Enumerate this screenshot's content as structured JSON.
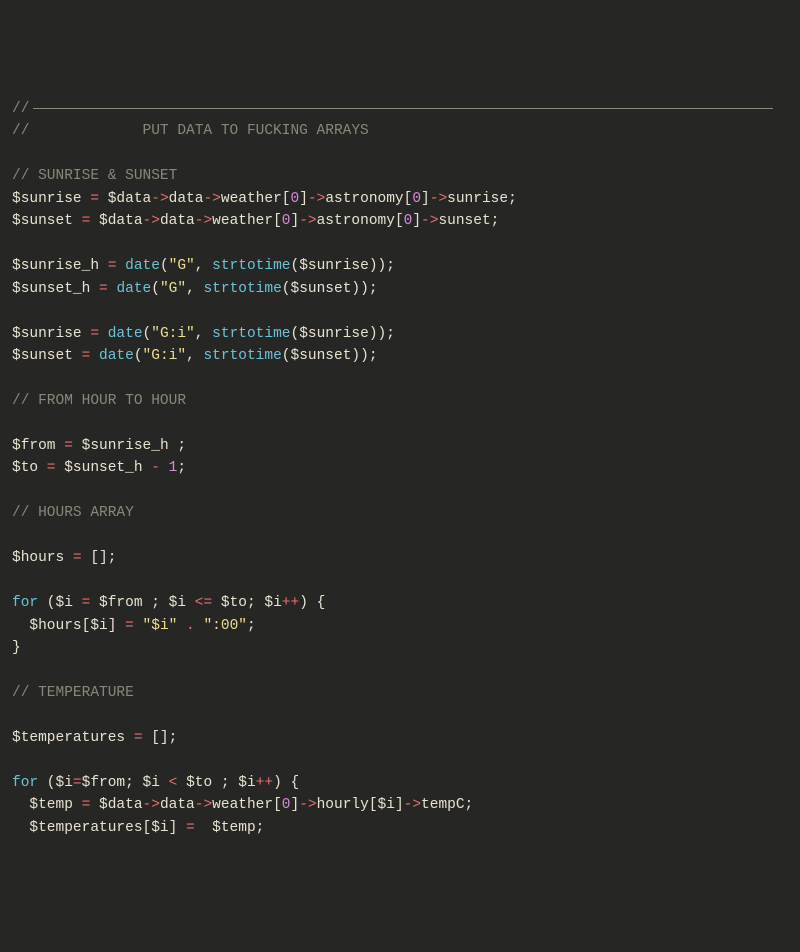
{
  "lines": {
    "l1_cm": "//",
    "l2_cm": "//             PUT DATA TO FUCKING ARRAYS",
    "l4_cm": "// SUNRISE & SUNSET",
    "l5": {
      "var1": "$sunrise",
      "eq": " = ",
      "var2": "$data",
      "arr1": "->",
      "p1": "data",
      "arr2": "->",
      "p2": "weather",
      "lb": "[",
      "n0": "0",
      "rb": "]",
      "arr3": "->",
      "p3": "astronomy",
      "lb2": "[",
      "n02": "0",
      "rb2": "]",
      "arr4": "->",
      "p4": "sunrise;"
    },
    "l6": {
      "var1": "$sunset",
      "eq": " = ",
      "var2": "$data",
      "arr1": "->",
      "p1": "data",
      "arr2": "->",
      "p2": "weather",
      "lb": "[",
      "n0": "0",
      "rb": "]",
      "arr3": "->",
      "p3": "astronomy",
      "lb2": "[",
      "n02": "0",
      "rb2": "]",
      "arr4": "->",
      "p4": "sunset;"
    },
    "l8": {
      "var1": "$sunrise_h",
      "eq": " = ",
      "fn": "date",
      "lp": "(",
      "s": "\"G\"",
      "comma": ", ",
      "fn2": "strtotime",
      "lp2": "(",
      "arg": "$sunrise",
      "rp": "));"
    },
    "l9": {
      "var1": "$sunset_h",
      "eq": " = ",
      "fn": "date",
      "lp": "(",
      "s": "\"G\"",
      "comma": ", ",
      "fn2": "strtotime",
      "lp2": "(",
      "arg": "$sunset",
      "rp": "));"
    },
    "l11": {
      "var1": "$sunrise",
      "eq": " = ",
      "fn": "date",
      "lp": "(",
      "s": "\"G:i\"",
      "comma": ", ",
      "fn2": "strtotime",
      "lp2": "(",
      "arg": "$sunrise",
      "rp": "));"
    },
    "l12": {
      "var1": "$sunset",
      "eq": " = ",
      "fn": "date",
      "lp": "(",
      "s": "\"G:i\"",
      "comma": ", ",
      "fn2": "strtotime",
      "lp2": "(",
      "arg": "$sunset",
      "rp": "));"
    },
    "l14_cm": "// FROM HOUR TO HOUR",
    "l16": {
      "var1": "$from",
      "eq": " = ",
      "var2": "$sunrise_h",
      "tail": " ;"
    },
    "l17": {
      "var1": "$to",
      "eq": " = ",
      "var2": "$sunset_h",
      "op": " - ",
      "n": "1",
      "tail": ";"
    },
    "l19_cm": "// HOURS ARRAY",
    "l21": {
      "var1": "$hours",
      "eq": " = ",
      "tail": "[];"
    },
    "l23": {
      "kw": "for",
      "lp": " (",
      "var1": "$i",
      "eq": " = ",
      "var2": "$from",
      "sep": " ; ",
      "var3": "$i",
      "cmp": " <= ",
      "var4": "$to",
      "sep2": "; ",
      "var5": "$i",
      "inc": "++",
      "rp": ") {"
    },
    "l24": {
      "pre": "  ",
      "var1": "$hours",
      "lb": "[",
      "idx": "$i",
      "rb": "]",
      "eq": " = ",
      "s1": "\"$i\"",
      "dot": " . ",
      "s2": "\":00\"",
      "tail": ";"
    },
    "l25": "}",
    "l27_cm": "// TEMPERATURE",
    "l29": {
      "var1": "$temperatures",
      "eq": " = ",
      "tail": "[];"
    },
    "l31": {
      "kw": "for",
      "lp": " (",
      "var1": "$i",
      "eq": "=",
      "var2": "$from",
      "sep": "; ",
      "var3": "$i",
      "cmp": " < ",
      "var4": "$to",
      "sep2": " ; ",
      "var5": "$i",
      "inc": "++",
      "rp": ") {"
    },
    "l32": {
      "pre": "  ",
      "var1": "$temp",
      "eq": " = ",
      "var2": "$data",
      "arr1": "->",
      "p1": "data",
      "arr2": "->",
      "p2": "weather",
      "lb": "[",
      "n0": "0",
      "rb": "]",
      "arr3": "->",
      "p3": "hourly",
      "lb2": "[",
      "idx": "$i",
      "rb2": "]",
      "arr4": "->",
      "p4": "tempC;"
    },
    "l33": {
      "pre": "  ",
      "var1": "$temperatures",
      "lb": "[",
      "idx": "$i",
      "rb": "]",
      "eq": " = ",
      "sp": " ",
      "var2": "$temp",
      "tail": ";"
    }
  }
}
